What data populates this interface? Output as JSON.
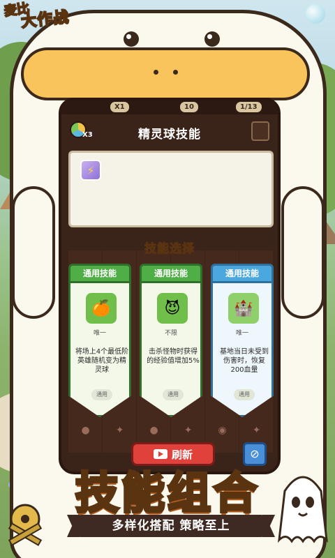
{
  "logo": {
    "line1": "麦比",
    "line2": "大作战"
  },
  "hud": {
    "chip1": "X1",
    "chip2": "10",
    "chip3": "1/13"
  },
  "panel": {
    "title": "精灵球技能",
    "orb_count": "X3"
  },
  "section": {
    "title": "技能选择"
  },
  "cards": [
    {
      "header": "通用技能",
      "icon": "🍊",
      "rarity": "唯一",
      "desc": "将场上4个最低阶英雄随机变为精灵球",
      "tag": "通用",
      "theme": "green"
    },
    {
      "header": "通用技能",
      "icon": "😈",
      "rarity": "不限",
      "desc": "击杀怪物时获得的经验值增加5%",
      "tag": "通用",
      "theme": "green"
    },
    {
      "header": "通用技能",
      "icon": "🏰",
      "rarity": "唯一",
      "desc": "基地当日未受到伤害时，恢复200血量",
      "tag": "通用",
      "theme": "blue"
    }
  ],
  "buttons": {
    "refresh": "刷新"
  },
  "promo": {
    "headline": "技能组合",
    "tagline": "多样化搭配 策略至上"
  },
  "colors": {
    "accent": "#ffd24a",
    "refresh": "#e0413a",
    "green_card": "#4fae45",
    "blue_card": "#4aa8de"
  }
}
